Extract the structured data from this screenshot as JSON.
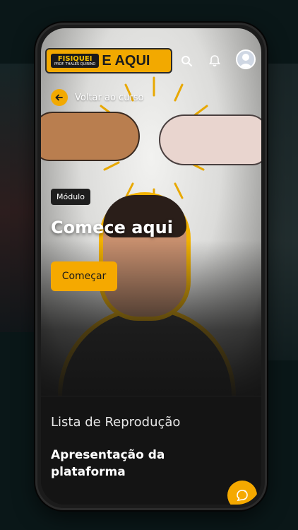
{
  "header": {
    "logo_brand": "FISIQUEI",
    "logo_subtitle": "PROF. THALES QUIRINO",
    "logo_text": "E AQUI",
    "icons": [
      "search-icon",
      "bell-icon",
      "user-avatar-icon"
    ]
  },
  "navigation": {
    "back_label": "Voltar ao curso"
  },
  "hero": {
    "tag": "Módulo",
    "title": "Comece aqui",
    "cta_label": "Começar"
  },
  "playlist": {
    "heading": "Lista de Reprodução",
    "items": [
      {
        "title": "Apresentação da plataforma"
      }
    ]
  },
  "colors": {
    "accent": "#f5a900",
    "background": "#141414",
    "text": "#ffffff"
  }
}
